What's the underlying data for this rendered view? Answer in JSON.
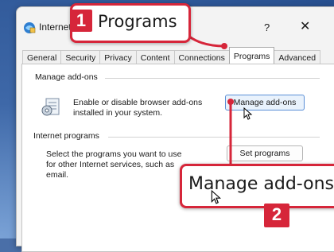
{
  "window": {
    "title": "Internet Options",
    "help_label": "?",
    "close_label": "✕"
  },
  "tabs": [
    {
      "label": "General"
    },
    {
      "label": "Security"
    },
    {
      "label": "Privacy"
    },
    {
      "label": "Content"
    },
    {
      "label": "Connections"
    },
    {
      "label": "Programs",
      "active": true
    },
    {
      "label": "Advanced"
    }
  ],
  "manage_addons": {
    "group_title": "Manage add-ons",
    "description_line1": "Enable or disable browser add-ons",
    "description_line2": "installed in your system.",
    "button_label": "Manage add-ons"
  },
  "internet_programs": {
    "group_title": "Internet programs",
    "description_line1": "Select the programs you want to use",
    "description_line2": "for other Internet services, such as",
    "description_line3": "email.",
    "button_label": "Set programs"
  },
  "annotations": {
    "step1": {
      "number": "1",
      "text": "Programs"
    },
    "step2": {
      "number": "2",
      "text": "Manage add-ons"
    },
    "accent_color": "#d6263a"
  }
}
